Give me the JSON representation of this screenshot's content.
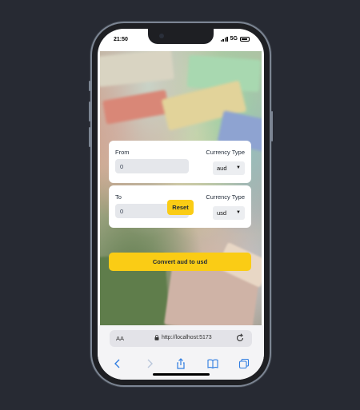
{
  "status_bar": {
    "time": "21:50",
    "network": "5G"
  },
  "converter": {
    "from": {
      "label": "From",
      "value": "0",
      "currency_label": "Currency Type",
      "currency": "aud"
    },
    "reset_label": "Reset",
    "to": {
      "label": "To",
      "value": "0",
      "currency_label": "Currency Type",
      "currency": "usd"
    },
    "convert_label": "Convert aud to usd"
  },
  "browser": {
    "text_size_label": "AA",
    "url": "http://localhost:5173",
    "icons": [
      "lock-icon",
      "reload-icon",
      "back-icon",
      "forward-icon",
      "share-icon",
      "bookmarks-icon",
      "tabs-icon"
    ]
  },
  "colors": {
    "accent": "#facc15",
    "background": "#272a33",
    "ios_blue": "#2f7de1"
  }
}
